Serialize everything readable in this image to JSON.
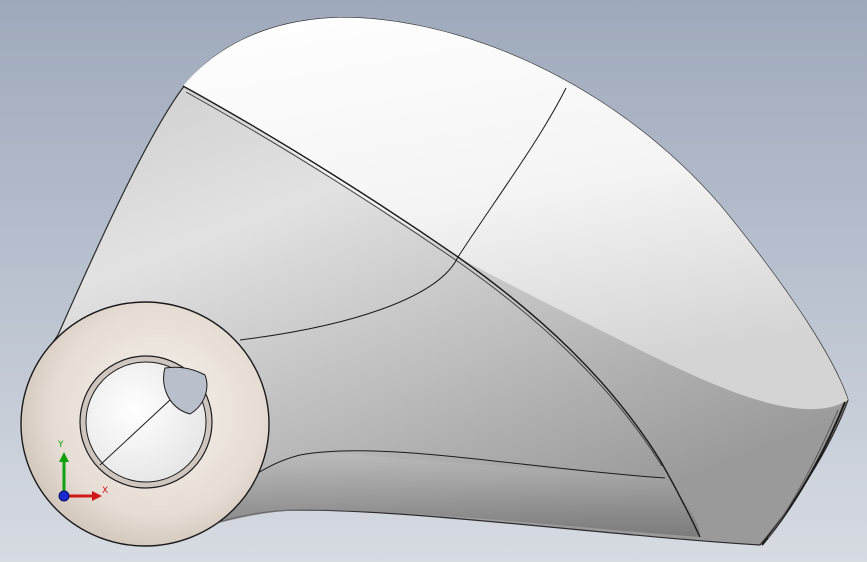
{
  "viewport": {
    "background_top": "#9ea9bb",
    "background_bottom": "#d7dbe2"
  },
  "model": {
    "body_color": "#f2f2f2",
    "edge_color": "#1a1a1a",
    "hub_color": "#e9e3dd"
  },
  "triad": {
    "x_label": "X",
    "y_label": "Y",
    "x_color": "#d01818",
    "y_color": "#10a010",
    "z_color": "#1a2ad0"
  }
}
